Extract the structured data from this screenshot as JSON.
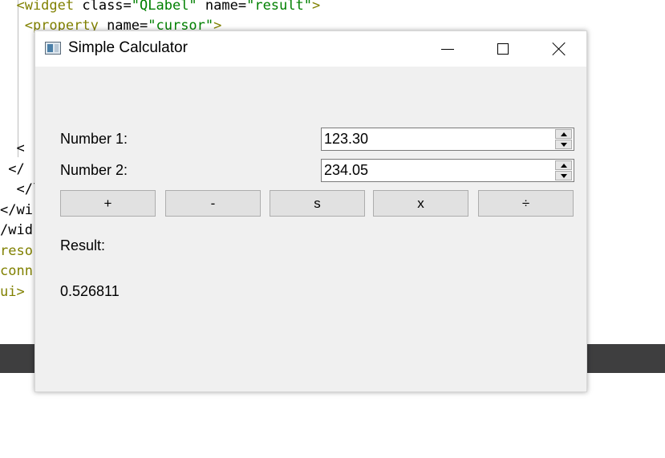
{
  "editor": {
    "lines": [
      {
        "tokens": [
          {
            "t": "  <widget",
            "c": "tag"
          },
          {
            "t": " class=",
            "c": "attr"
          },
          {
            "t": "\"QLabel\"",
            "c": "val"
          },
          {
            "t": " name=",
            "c": "attr"
          },
          {
            "t": "\"result\"",
            "c": "val"
          },
          {
            "t": ">",
            "c": "tag"
          }
        ]
      },
      {
        "tokens": [
          {
            "t": "   <property",
            "c": "tag"
          },
          {
            "t": " name=",
            "c": "attr"
          },
          {
            "t": "\"cursor\"",
            "c": "val"
          },
          {
            "t": ">",
            "c": "tag"
          }
        ]
      },
      {
        "tokens": [
          {
            "t": "  <",
            "c": "plain"
          }
        ]
      },
      {
        "tokens": [
          {
            "t": " </",
            "c": "plain"
          }
        ]
      },
      {
        "tokens": [
          {
            "t": "  </l",
            "c": "plain"
          }
        ]
      },
      {
        "tokens": [
          {
            "t": "</wi",
            "c": "plain"
          }
        ]
      },
      {
        "tokens": [
          {
            "t": "/wid",
            "c": "plain"
          }
        ]
      },
      {
        "tokens": [
          {
            "t": "reso",
            "c": "tag"
          }
        ]
      },
      {
        "tokens": [
          {
            "t": "conn",
            "c": "tag"
          }
        ]
      },
      {
        "tokens": [
          {
            "t": "ui>",
            "c": "tag"
          }
        ]
      }
    ]
  },
  "window": {
    "title": "Simple Calculator",
    "number1_label": "Number 1:",
    "number1_value": "123.30",
    "number2_label": "Number 2:",
    "number2_value": "234.05",
    "buttons": {
      "add": "+",
      "subtract": "-",
      "s": "s",
      "multiply": "x",
      "divide": "÷"
    },
    "result_label": "Result:",
    "result_value": "0.526811"
  },
  "colors": {
    "window_bg": "#f0f0f0",
    "titlebar_bg": "#ffffff",
    "button_bg": "#e1e1e1",
    "button_border": "#adadad",
    "xml_tag": "#808000",
    "xml_value": "#008000",
    "dark_band": "#3e3e3f"
  },
  "icons": {
    "app": "window-app-icon",
    "minimize": "minimize-icon",
    "maximize": "maximize-icon",
    "close": "close-icon",
    "spin_up": "chevron-up-icon",
    "spin_down": "chevron-down-icon"
  }
}
